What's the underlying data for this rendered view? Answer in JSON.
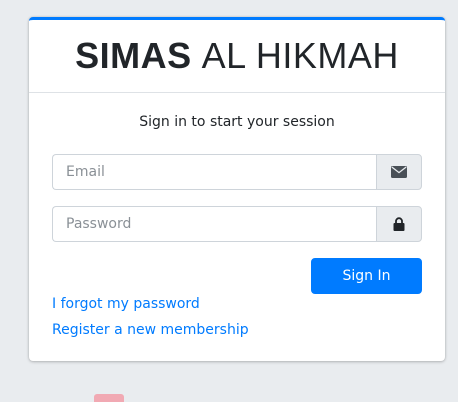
{
  "brand": {
    "bold_text": "SIMAS",
    "light_text": "AL HIKMAH"
  },
  "login": {
    "message": "Sign in to start your session",
    "email": {
      "placeholder": "Email",
      "value": "",
      "icon": "envelope-icon"
    },
    "password": {
      "placeholder": "Password",
      "value": "",
      "icon": "lock-icon"
    },
    "submit_label": "Sign In",
    "forgot_link": "I forgot my password",
    "register_link": "Register a new membership"
  },
  "colors": {
    "accent": "#007bff",
    "background": "#e9ecef",
    "card": "#ffffff"
  }
}
